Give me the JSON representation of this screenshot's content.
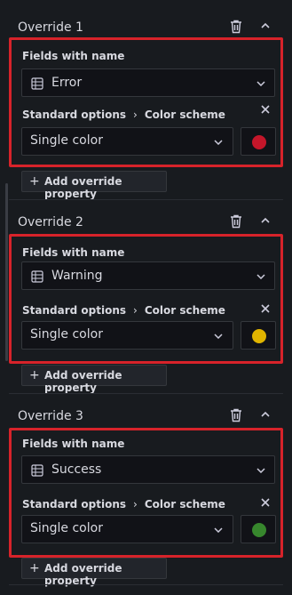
{
  "overrides": [
    {
      "title": "Override 1",
      "field_label": "Fields with name",
      "field_value": "Error",
      "property_path": [
        "Standard options",
        "Color scheme"
      ],
      "scheme_value": "Single color",
      "color": "#c4162a",
      "add_label": "Add override property"
    },
    {
      "title": "Override 2",
      "field_label": "Fields with name",
      "field_value": "Warning",
      "property_path": [
        "Standard options",
        "Color scheme"
      ],
      "scheme_value": "Single color",
      "color": "#e0b400",
      "add_label": "Add override property"
    },
    {
      "title": "Override 3",
      "field_label": "Fields with name",
      "field_value": "Success",
      "property_path": [
        "Standard options",
        "Color scheme"
      ],
      "scheme_value": "Single color",
      "color": "#37872d",
      "add_label": "Add override property"
    }
  ],
  "icons": {
    "delete": "trash-icon",
    "collapse": "chevron-up-icon",
    "field": "field-name-icon",
    "dropdown": "chevron-down-icon",
    "remove": "close-icon",
    "add": "plus-icon"
  },
  "colors": {
    "highlight": "#d7232a",
    "background": "#181b1f"
  }
}
